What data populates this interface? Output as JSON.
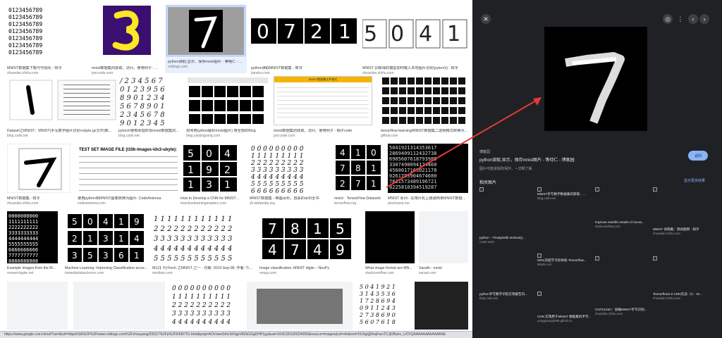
{
  "grid": {
    "row1": [
      {
        "caption": "MNIST数据集下载与可视化 - 知乎",
        "source": "zhuanlan.zhihu.com"
      },
      {
        "caption": "mnist数据集的获取、访问、使用例子 - 柚子...",
        "source": "jxsccode.com"
      },
      {
        "caption": "python读取,显示，保存mnist图片 - 等哦仁 - 博...",
        "source": "cnblogs.com"
      },
      {
        "caption": "python读取MNIST数据集 - 简书",
        "source": "jianshu.com"
      },
      {
        "caption": "MNIST 训练得的模型如何载入本地图片识别(pytorch) - 知乎",
        "source": "zhuanlan.zhihu.com"
      }
    ],
    "row2": [
      {
        "caption": "Dataset之MNIST：MNIST(手写数字图片识别+ubyte.gz文件)数...",
        "source": "blog.csdn.net"
      },
      {
        "caption": "pytorch使用原理实现mnist数据集的...",
        "source": "blog.csdn.net"
      },
      {
        "caption": "如何用python解析mnist图片) 用全部的Blog",
        "source": "blog.yanjingyang.com"
      },
      {
        "caption": "mnist数据集的获取、访问、使用例子 - 柚子code",
        "source": "jxsccode.com"
      },
      {
        "caption": "tensorflow-learning/MNIST数据集二进制格式转换为...",
        "source": "github.com"
      }
    ],
    "row3": [
      {
        "caption": "MNIST数据集 - 知乎",
        "source": "zhuanlan.zhihu.com"
      },
      {
        "caption": "使用python和MNIST图像转换为图片- CodeAntenna",
        "source": "codeantenna.com"
      },
      {
        "caption": "How to Develop a CNN for MNIST Ha...",
        "source": "machinelearningmastery.com"
      },
      {
        "caption": "MNIST数据集 - 维基百科，自由的百科全书",
        "source": "zh.wikipedia.org"
      },
      {
        "caption": "mnist：TensorFlow Datasets",
        "source": "tensorflow.org"
      },
      {
        "caption": "MNIST 系列 - 在用片机上跑通简单MNIST数据集...",
        "source": "pinchesse.me"
      }
    ],
    "row4": [
      {
        "caption": "Example images from the M...",
        "source": "researchgate.net"
      },
      {
        "caption": "Machine Learning: Improving Classification accur...",
        "source": "towardsdatascience.com"
      },
      {
        "caption": "M12】PyTorch 之MNIST 之一 - 日期: 2019-Sep-08, 作者: Tim ...",
        "source": "medium.com"
      },
      {
        "caption": "Image classification, MNIST digits – NeuPy",
        "source": "neupy.com"
      },
      {
        "caption": "What image format are MN...",
        "source": "stackoverflow.com"
      },
      {
        "caption": "SaraAI - mnist",
        "source": "saraai.com"
      }
    ],
    "table_thumb_header": "MNIST数据集文件格式"
  },
  "panel": {
    "source_label": "博客园",
    "title": "python读取,显示，保存mnist图片 - 等待仁 - 博客园",
    "visit_label": "访问",
    "note": "图片可能受版权保护。 • 详细了解",
    "related_title": "相关图片",
    "see_more": "显示更多结果",
    "related": [
      {
        "title": "MNIST手写数字数据集的获取、...",
        "source": "blog.csdn.net"
      },
      {
        "title": "Improve real-life results of neura...",
        "source": "stackoverflow.com"
      },
      {
        "title": "MNIST 训练集：测试图例 - 知乎",
        "source": "zhuanlan.zhihu.com"
      },
      {
        "title": "python - ?/matplotlib imshow()...",
        "source": "codei.work"
      },
      {
        "title": "0001深度学习初体验-Tensorflow...",
        "source": "kittelli.com"
      },
      {
        "title": "python手写数字识别实现报告白...",
        "source": "blog.csdn.net"
      },
      {
        "title": "CNN 实现原于MNIST 数据集的手写...",
        "source": "yongguang2009.github.io"
      },
      {
        "title": "CNTK103A：加载MNIST手写识别...",
        "source": "zhuanlan.zhihu.com"
      },
      {
        "title": "Tensorflow2.0 CNN实战（1）-M...",
        "source": "zhuanlan.zhihu.com"
      }
    ]
  },
  "status_url": "https://www.google.com.hk/url?sa=i&url=https%3A%2F%2Fwww.cnblogs.com%2Fzhouyang209117%2Fp%2F6436751.html&psig=AOvVaw3xhL6rDqpV8ZbGGgDHH1gy&ust=1642181629334000&source=images&cd=vfe&ved=0CAgQjRxqFwoTCJjOBahv_UCFQAAAAAdAAAAABAE",
  "colors": {
    "accent": "#8ab4f8",
    "panel_bg": "#202124",
    "arrow": "#e53935"
  },
  "icons": {
    "close": "close-icon",
    "lens": "lens-icon",
    "more": "more-vert-icon",
    "prev": "chevron-left-icon",
    "next": "chevron-right-icon"
  }
}
